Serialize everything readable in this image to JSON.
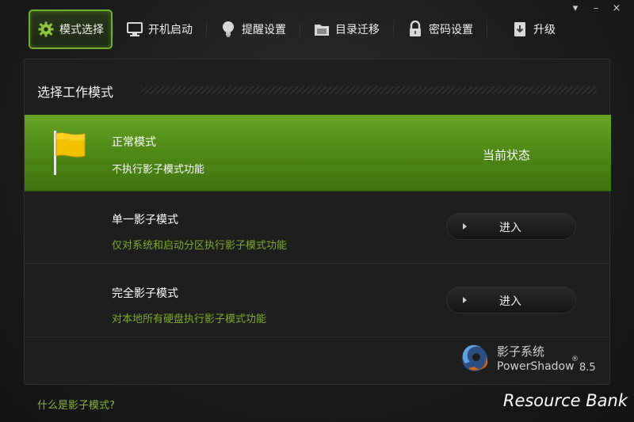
{
  "window": {
    "controls": [
      "▾",
      "–",
      "×"
    ]
  },
  "tabs": [
    {
      "label": "模式选择",
      "icon": "gear-icon",
      "active": true
    },
    {
      "label": "开机启动",
      "icon": "monitor-icon",
      "active": false
    },
    {
      "label": "提醒设置",
      "icon": "lightbulb-icon",
      "active": false
    },
    {
      "label": "目录迁移",
      "icon": "folder-icon",
      "active": false
    },
    {
      "label": "密码设置",
      "icon": "lock-icon",
      "active": false
    },
    {
      "label": "升级",
      "icon": "download-icon",
      "active": false
    }
  ],
  "panel": {
    "title": "选择工作模式",
    "modes": [
      {
        "name": "正常模式",
        "desc": "不执行影子模式功能",
        "status": "当前状态"
      },
      {
        "name": "单一影子模式",
        "desc": "仅对系统和启动分区执行影子模式功能",
        "button": "进入"
      },
      {
        "name": "完全影子模式",
        "desc": "对本地所有硬盘执行影子模式功能",
        "button": "进入"
      }
    ]
  },
  "brand": {
    "name_cn": "影子系统",
    "name_en": "PowerShadow",
    "registered": "®",
    "version": "8.5"
  },
  "footer": {
    "help_link": "什么是影子模式?"
  },
  "watermark": "Resource Bank",
  "colors": {
    "accent_green": "#5a9a1e",
    "desc_green": "#7ea92a",
    "background": "#1c1c1c"
  }
}
